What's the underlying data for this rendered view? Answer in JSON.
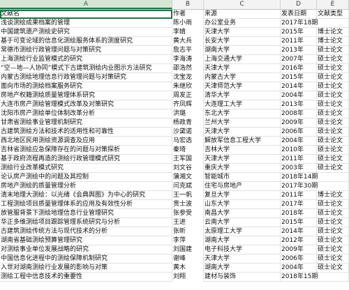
{
  "column_headers": [
    "A",
    "B",
    "C",
    "D",
    "E"
  ],
  "header_row": {
    "a": "文献名",
    "b": "作者",
    "c": "来源",
    "d": "发表日期",
    "e": "文献类型"
  },
  "rows": [
    {
      "a": "浅谈测绘成果档案的管理",
      "b": "陈小雨",
      "c": "办公室业务",
      "d": "2017年18期",
      "e": ""
    },
    {
      "a": "中国建筑遗产测绘史研究",
      "b": "李婧",
      "c": "天津大学",
      "d": "2015年",
      "e": "博士论文"
    },
    {
      "a": "基于可变论域的信息化测绘服务体系的测度研究",
      "b": "黄大兵",
      "c": "长安大学",
      "d": "2011年",
      "e": "博士论文"
    },
    {
      "a": "常德市测绘行政管理问题与对策研究",
      "b": "詹志平",
      "c": "湖南大学",
      "d": "2013年",
      "e": "硕士论文"
    },
    {
      "a": "上海测绘行业监管模式的研究",
      "b": "李海涛",
      "c": "上海交通大学",
      "d": "2007年",
      "e": "硕士论文"
    },
    {
      "a": "“空—地—人协同”模式下古建筑测绘内业图示方法研究",
      "b": "邵浩然",
      "c": "天津大学",
      "d": "2016年",
      "e": "硕士论文"
    },
    {
      "a": "内蒙古测绘地理信息行政管理问题与对策研究",
      "b": "沈宝龙",
      "c": "内蒙古大学",
      "d": "2015年",
      "e": "硕士论文"
    },
    {
      "a": "面向市场的测绘档案服务研究",
      "b": "朱继欣",
      "c": "天津师范大学",
      "d": "2014年",
      "e": "硕士论文"
    },
    {
      "a": "房地产权籍测绘质量管理体系研究",
      "b": "周发正",
      "c": "清华大学",
      "d": "2004年",
      "e": "硕士论文"
    },
    {
      "a": "大连市房产测绘管理模式改革及对策研究",
      "b": "齐凤辉",
      "c": "大连理工大学",
      "d": "2013年",
      "e": "硕士论文"
    },
    {
      "a": "沈阳市房产测绘单位体制改革分析",
      "b": "洪璐",
      "c": "东北大学",
      "d": "2008年",
      "e": "硕士论文"
    },
    {
      "a": "甘肃省测绘事业管理机制研究",
      "b": "杨政青",
      "c": "兰州大学",
      "d": "2009年",
      "e": "硕士论文"
    },
    {
      "a": "古建筑测绘方法和技术的适用性和可靠性",
      "b": "沙黛诺",
      "c": "天津大学",
      "d": "2006年",
      "e": "硕士论文"
    },
    {
      "a": "西北地区民用测绘资源调查及应用",
      "b": "马宏选",
      "c": "解放军信息工程大学",
      "d": "2004年",
      "e": "硕士论文"
    },
    {
      "a": "吉林省测绘应急保障存在的问题与对策探析",
      "b": "秦琦",
      "c": "吉林大学",
      "d": "2010年",
      "e": "硕士论文"
    },
    {
      "a": "基于政府流程再造的测绘行政管理模式研究",
      "b": "王军国",
      "c": "天津大学",
      "d": "2011年",
      "e": "硕士论文"
    },
    {
      "a": "测绘行业改革模式研究",
      "b": "刘文谷",
      "c": "重庆大学",
      "d": "2003年",
      "e": "硕士论文"
    },
    {
      "a": "论认房产测绘中的问题及其控制",
      "b": "蒲湘文",
      "c": "智能城市",
      "d": "2018年14期",
      "e": ""
    },
    {
      "a": "房地产测绘的质量管理分析",
      "b": "闫克斌",
      "c": "住宅与房地产",
      "d": "2017年30期",
      "e": ""
    },
    {
      "a": "清末地理大测绘：以光绪《会典舆图》为中心的研究",
      "b": "王一帆",
      "c": "复旦大学",
      "d": "2011年",
      "e": "博士论文"
    },
    {
      "a": "工程测绘项目质量管理体系的应用及有效性分析",
      "b": "贯士波",
      "c": "山东大学",
      "d": "2017年",
      "e": "硕士论文"
    },
    {
      "a": "放管服背景下测绘地理信息行业管理研究",
      "b": "张参受",
      "c": "南昌大学",
      "d": "2018年",
      "e": "硕士论文"
    },
    {
      "a": "华正多维测绘项目跟踪管理系统研究与分析",
      "b": "王进",
      "c": "云南大学",
      "d": "2015年",
      "e": "硕士论文"
    },
    {
      "a": "古建筑测绘传统方法与现代技术的分析",
      "b": "张昕",
      "c": "太原理工大学",
      "d": "2014年",
      "e": "硕士论文"
    },
    {
      "a": "湖南省基础测绘预算管理研究",
      "b": "李萍",
      "c": "湖南大学",
      "d": "2012年",
      "e": "硕士论文"
    },
    {
      "a": "对测绘事业单位发展战略的研究",
      "b": "刘国建",
      "c": "电子科技大学",
      "d": "2009年",
      "e": "硕士论文"
    },
    {
      "a": "中国信息化进程中的测绘保障机制研究",
      "b": "谢峰",
      "c": "天津大学",
      "d": "2006年",
      "e": "硕士论文"
    },
    {
      "a": "入世对湖南测绘行业发展的影响与对策",
      "b": "黄木",
      "c": "湖南大学",
      "d": "2004年",
      "e": "硕士论文"
    },
    {
      "a": "测绘工程中信息技术的重要性",
      "b": "刘翔",
      "c": "建材与装饰",
      "d": "2018年15期",
      "e": ""
    }
  ]
}
